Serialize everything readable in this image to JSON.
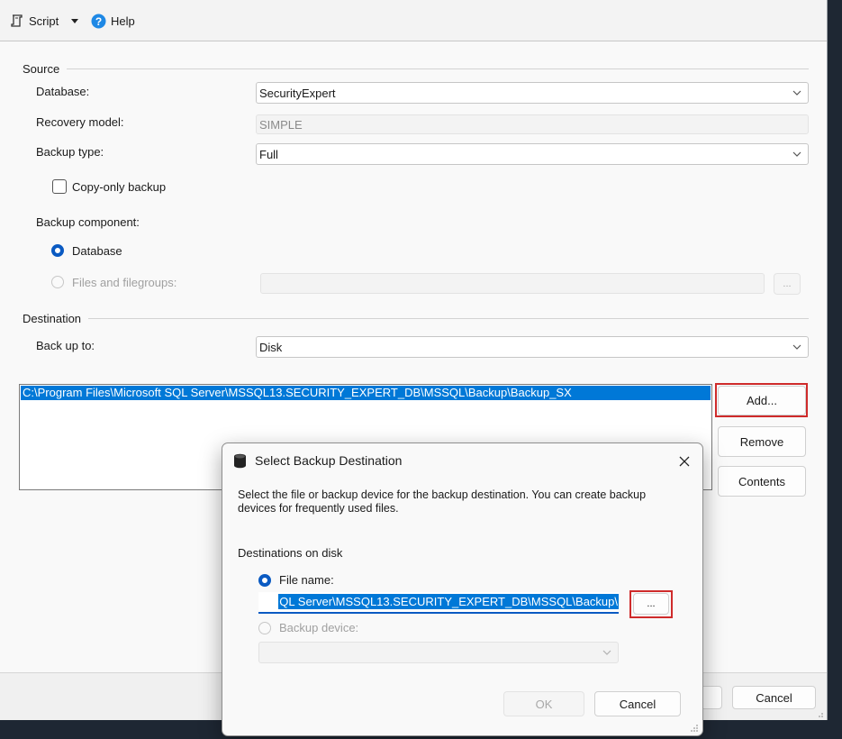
{
  "toolbar": {
    "script_label": "Script",
    "help_label": "Help"
  },
  "source": {
    "section_title": "Source",
    "database_label": "Database:",
    "database_value": "SecurityExpert",
    "recovery_model_label": "Recovery model:",
    "recovery_model_value": "SIMPLE",
    "backup_type_label": "Backup type:",
    "backup_type_value": "Full",
    "copy_only_label": "Copy-only backup",
    "component_label": "Backup component:",
    "component_database_label": "Database",
    "component_files_label": "Files and filegroups:",
    "files_browse_label": "..."
  },
  "destination": {
    "section_title": "Destination",
    "backup_to_label": "Back up to:",
    "backup_to_value": "Disk",
    "paths": [
      "C:\\Program Files\\Microsoft SQL Server\\MSSQL13.SECURITY_EXPERT_DB\\MSSQL\\Backup\\Backup_SX"
    ],
    "add_button": "Add...",
    "remove_button": "Remove",
    "contents_button": "Contents"
  },
  "footer": {
    "cancel_button": "Cancel"
  },
  "dialog": {
    "title": "Select Backup Destination",
    "description": "Select the file or backup device for the backup destination. You can create backup devices for frequently used files.",
    "section_label": "Destinations on disk",
    "file_name_label": "File name:",
    "file_name_value": "QL Server\\MSSQL13.SECURITY_EXPERT_DB\\MSSQL\\Backup\\",
    "browse_button": "...",
    "backup_device_label": "Backup device:",
    "ok_button": "OK",
    "cancel_button": "Cancel"
  },
  "colors": {
    "accent": "#0a5ac2",
    "selection": "#0078d7",
    "highlight_box": "#cf2b2b",
    "help_icon": "#1e88e5"
  }
}
